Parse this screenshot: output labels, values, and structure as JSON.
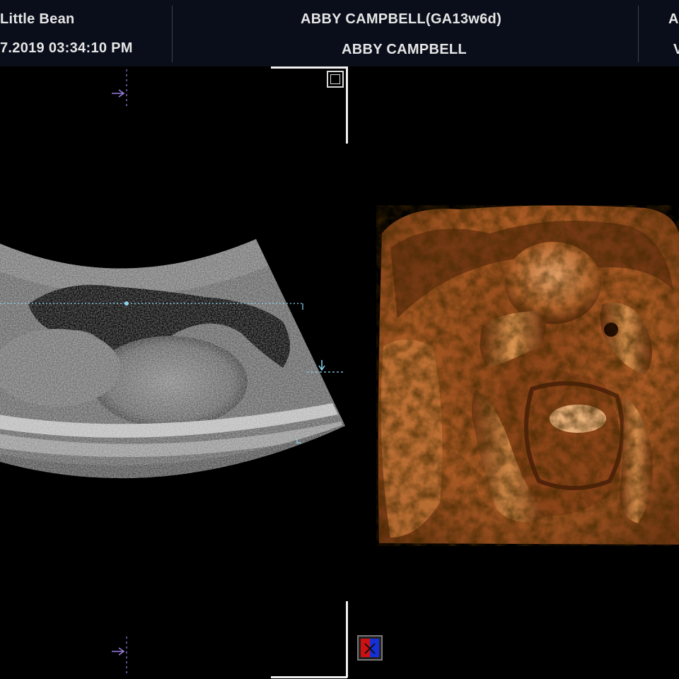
{
  "header": {
    "left_line1": "Little Bean",
    "left_line2": "7.2019   03:34:10 PM",
    "center_line1": "ABBY CAMPBELL(GA13w6d)",
    "center_line2": "ABBY CAMPBELL",
    "right_line1": "A",
    "right_line2": "V"
  },
  "colors": {
    "header_bg": "#0a0e1a",
    "render_tone": "#b0622a",
    "marker_purple": "#9b7fe0",
    "cursor_cyan": "#8fd3ee",
    "toggle_red": "#d01010",
    "toggle_blue": "#1630d8"
  },
  "icons": {
    "frame": "frame-icon",
    "color_map": "color-map-toggle-icon",
    "top_marker": "focus-marker-icon",
    "bottom_marker": "focus-marker-icon",
    "right_marker": "depth-marker-icon"
  }
}
